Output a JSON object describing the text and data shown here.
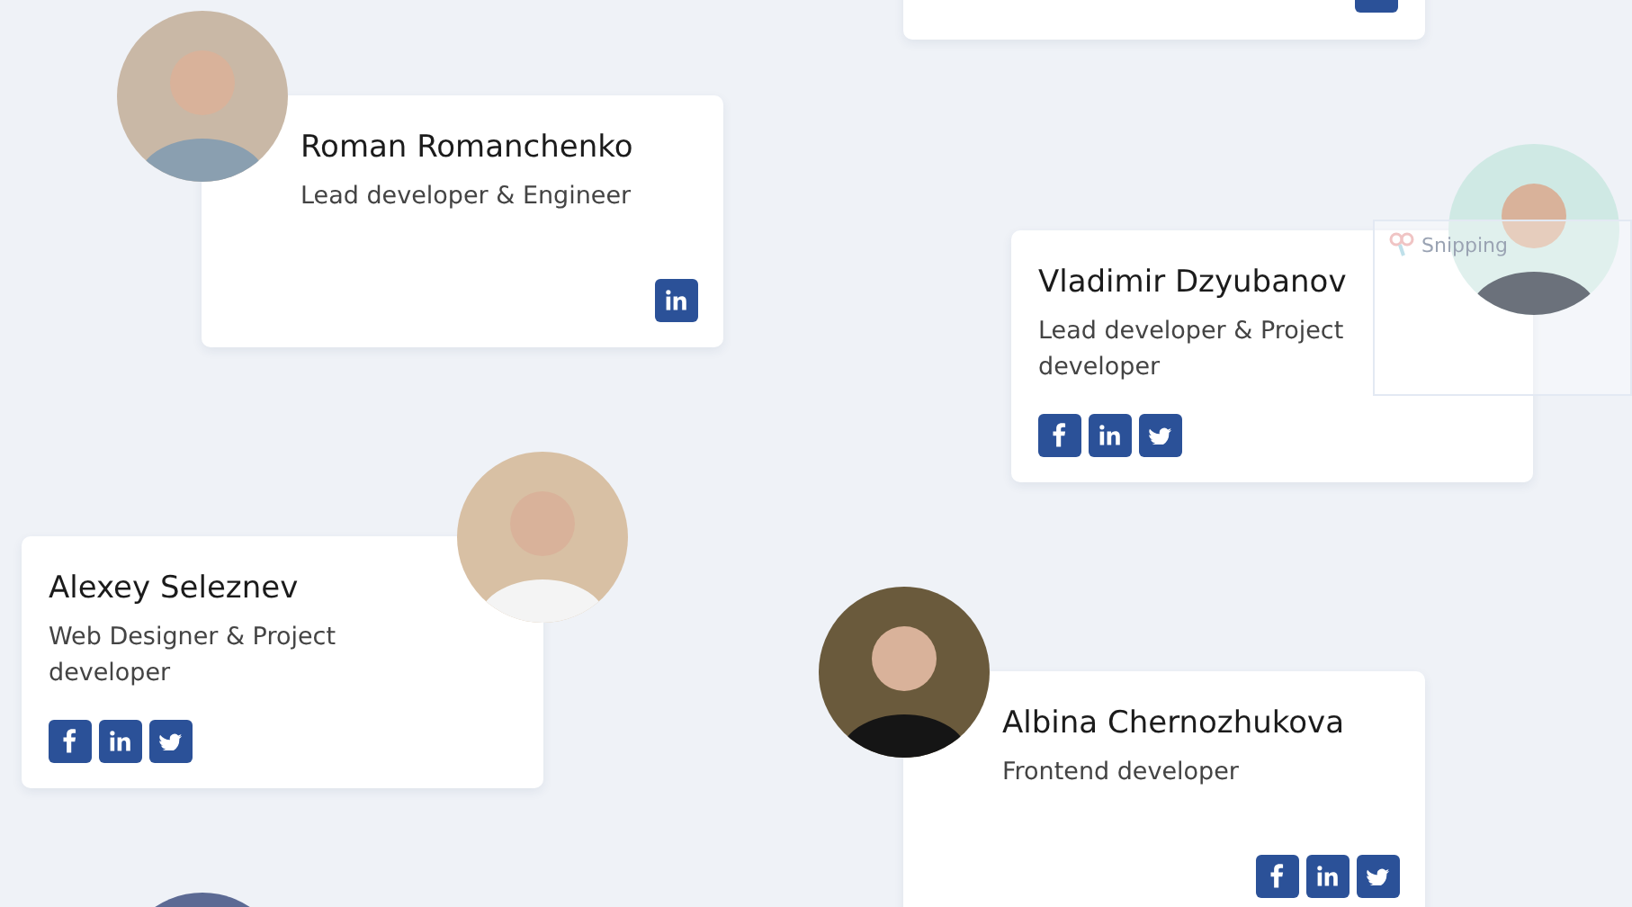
{
  "members": [
    {
      "kind": "full",
      "name": "Roman Romanchenko",
      "role": "Lead developer & Engineer",
      "links": [
        {
          "kind": "linkedin"
        }
      ]
    },
    {
      "kind": "full",
      "name": "Vladimir Dzyubanov",
      "role": "Lead developer & Project developer",
      "links": [
        {
          "kind": "facebook"
        },
        {
          "kind": "linkedin"
        },
        {
          "kind": "twitter"
        }
      ]
    },
    {
      "kind": "full",
      "name": "Alexey Seleznev",
      "role": "Web Designer & Project developer",
      "links": [
        {
          "kind": "facebook"
        },
        {
          "kind": "linkedin"
        },
        {
          "kind": "twitter"
        }
      ]
    },
    {
      "kind": "full",
      "name": "Albina Chernozhukova",
      "role": "Frontend developer",
      "links": [
        {
          "kind": "facebook"
        },
        {
          "kind": "linkedin"
        },
        {
          "kind": "twitter"
        }
      ]
    }
  ],
  "overlay": {
    "title": "Snipping"
  }
}
